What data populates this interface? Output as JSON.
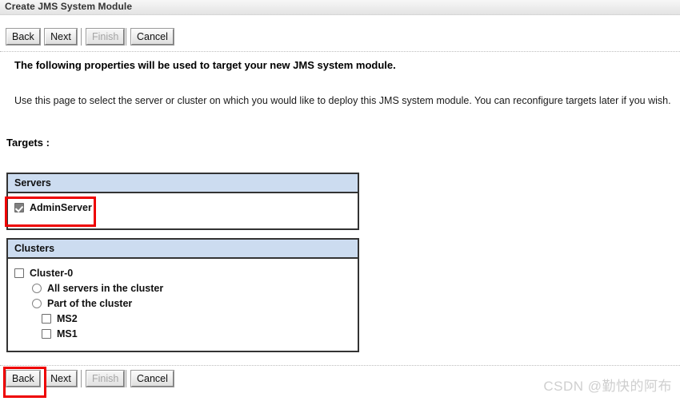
{
  "window": {
    "title": "Create JMS System Module"
  },
  "toolbar": {
    "buttons": [
      {
        "label": "Back",
        "disabled": false
      },
      {
        "label": "Next",
        "disabled": false
      },
      {
        "label": "Finish",
        "disabled": true
      },
      {
        "label": "Cancel",
        "disabled": false
      }
    ]
  },
  "content": {
    "heading": "The following properties will be used to target your new JMS system module.",
    "description": "Use this page to select the server or cluster on which you would like to deploy this JMS system module. You can reconfigure targets later if you wish.",
    "targets_label": "Targets :"
  },
  "servers_table": {
    "header": "Servers",
    "rows": [
      {
        "label": "AdminServer",
        "control": "checkbox",
        "checked": true,
        "disabled": true
      }
    ]
  },
  "clusters_table": {
    "header": "Clusters",
    "rows": [
      {
        "label": "Cluster-0",
        "control": "checkbox",
        "checked": false,
        "indent": 0
      },
      {
        "label": "All servers in the cluster",
        "control": "radio",
        "checked": false,
        "indent": 1
      },
      {
        "label": "Part of the cluster",
        "control": "radio",
        "checked": false,
        "indent": 1
      },
      {
        "label": "MS2",
        "control": "checkbox",
        "checked": false,
        "indent": 2
      },
      {
        "label": "MS1",
        "control": "checkbox",
        "checked": false,
        "indent": 2
      }
    ]
  },
  "annotations": {
    "color": "#ee0000",
    "boxes": [
      "adminserver-checkbox",
      "bottom-back-button"
    ]
  },
  "watermark": {
    "text": "CSDN @勤快的阿布",
    "color": "#cfcfcf"
  }
}
